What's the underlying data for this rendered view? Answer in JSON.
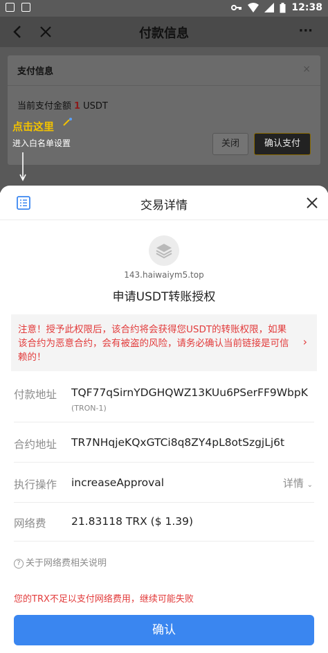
{
  "status_bar": {
    "time": "12:38"
  },
  "nav": {
    "title": "付款信息",
    "more": "···"
  },
  "payment_dialog": {
    "title": "支付信息",
    "close_x": "×",
    "amount_prefix": "当前支付金额",
    "amount_value": "1",
    "amount_unit": "USDT",
    "close_label": "关闭",
    "confirm_label": "确认支付"
  },
  "annotation": {
    "click_here": "点击这里",
    "whitelist": "进入白名单设置"
  },
  "sheet": {
    "title": "交易详情",
    "domain": "143.haiwaiym5.top",
    "auth_title": "申请USDT转账授权",
    "warning": "注意！授予此权限后，该合约将会获得您USDT的转账权限，如果该合约为恶意合约，会有被盗的风险，请务必确认当前链接是可信赖的！",
    "payer_label": "付款地址",
    "payer_value": "TQF77qSirnYDGHQWZ13KUu6PSerFF9WbpK",
    "payer_network": "(TRON-1)",
    "contract_label": "合约地址",
    "contract_value": "TR7NHqjeKQxGTCi8q8ZY4pL8otSzgjLj6t",
    "operation_label": "执行操作",
    "operation_value": "increaseApproval",
    "details_link": "详情",
    "fee_label": "网络费",
    "fee_value": "21.83118 TRX ($ 1.39)",
    "fee_note": "关于网络费相关说明",
    "insufficient": "您的TRX不足以支付网络费用，继续可能失败",
    "confirm": "确认"
  },
  "colors": {
    "primary_button": "#3a86f0",
    "warning_text": "#e23b3b",
    "highlight": "#f2c200"
  },
  "icons": [
    "back-arrow-icon",
    "close-icon",
    "list-icon",
    "layers-icon",
    "question-circle-icon",
    "chevron-right-icon",
    "chevron-down-icon"
  ]
}
